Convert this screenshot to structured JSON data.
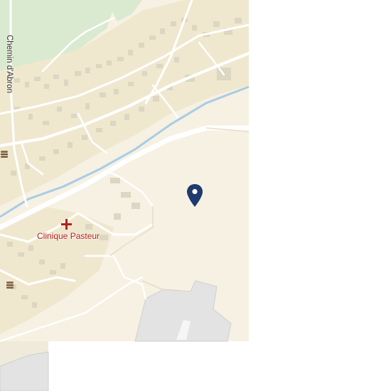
{
  "map": {
    "roads": {
      "chemin_dabron": "Chemin d'Abron"
    },
    "pois": {
      "clinic": {
        "name": "Clinique Pasteur",
        "icon": "medical-cross-icon",
        "color": "#b3201c"
      },
      "restaurants": [
        {
          "icon": "burger-icon"
        },
        {
          "icon": "burger-icon"
        }
      ]
    },
    "marker": {
      "icon": "map-pin-icon",
      "color": "#1e3a6e"
    },
    "colors": {
      "land": "#f6f1e2",
      "residential": "#efe8cf",
      "park": "#d9ead0",
      "water": "#a8cce6",
      "airport": "#e3e3e3",
      "road": "#ffffff",
      "building": "#dcd6c2"
    }
  }
}
